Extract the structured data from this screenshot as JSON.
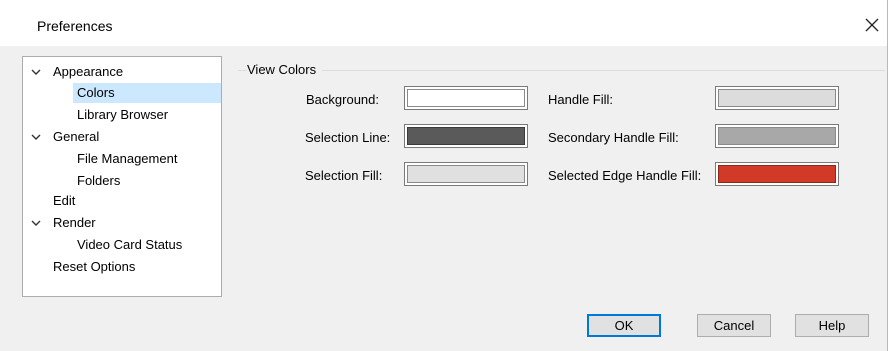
{
  "window": {
    "title": "Preferences",
    "close_glyph": "✕"
  },
  "tree": {
    "items": [
      {
        "label": "Appearance",
        "expanded": true,
        "level": 0
      },
      {
        "label": "Colors",
        "level": 1,
        "selected": true
      },
      {
        "label": "Library Browser",
        "level": 1
      },
      {
        "label": "General",
        "expanded": true,
        "level": 0
      },
      {
        "label": "File Management",
        "level": 1
      },
      {
        "label": "Folders",
        "level": 1
      },
      {
        "label": "Edit",
        "level": 0
      },
      {
        "label": "Render",
        "expanded": true,
        "level": 0
      },
      {
        "label": "Video Card Status",
        "level": 1
      },
      {
        "label": "Reset Options",
        "level": 0
      }
    ]
  },
  "view_colors": {
    "group_label": "View Colors",
    "fields": [
      {
        "label": "Background:",
        "color": "#ffffff"
      },
      {
        "label": "Selection Line:",
        "color": "#5a5a5a"
      },
      {
        "label": "Selection Fill:",
        "color": "#e0e0e0"
      },
      {
        "label": "Handle Fill:",
        "color": "#dcdcdc"
      },
      {
        "label": "Secondary Handle Fill:",
        "color": "#a8a8a8"
      },
      {
        "label": "Selected Edge Handle Fill:",
        "color": "#d03a26"
      }
    ]
  },
  "buttons": {
    "ok": "OK",
    "cancel": "Cancel",
    "help": "Help"
  },
  "colors": {
    "selection_highlight": "#cce8ff",
    "default_button_border": "#0078d7"
  }
}
